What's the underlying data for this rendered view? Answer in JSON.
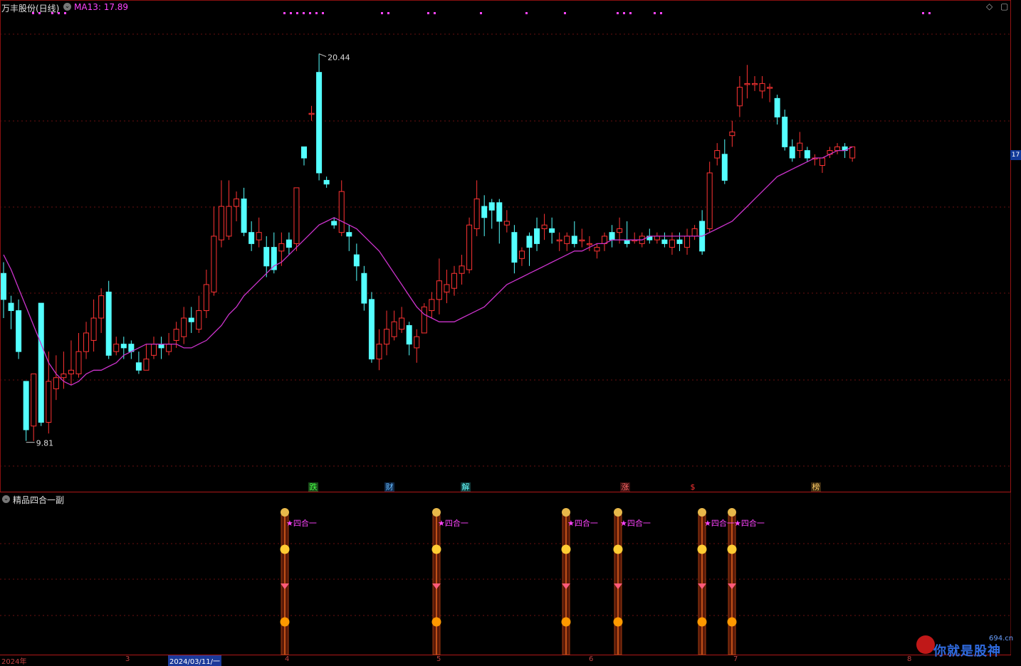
{
  "header": {
    "stock_title": "万丰股份(日线)",
    "ma_label": "MA13: 17.89",
    "collapse_glyph": "⌄",
    "diamond_icon": "◇",
    "window_icon": "▢"
  },
  "chart_data": {
    "type": "candlestick",
    "ylim": [
      9,
      21.5
    ],
    "up_color": "#ff3333",
    "down_color": "#54ffff",
    "ma_color": "#cc33cc",
    "high_label": "20.44",
    "low_label": "9.81",
    "right_price_tag": "17",
    "candles": [
      [
        14.5,
        13.8,
        14.8,
        13.3
      ],
      [
        13.7,
        13.5,
        13.9,
        13.0
      ],
      [
        13.5,
        12.4,
        13.8,
        12.2
      ],
      [
        11.6,
        10.3,
        11.6,
        10.0
      ],
      [
        10.4,
        11.8,
        11.8,
        10.0
      ],
      [
        13.7,
        10.5,
        13.7,
        10.4
      ],
      [
        10.5,
        11.6,
        12.4,
        10.2
      ],
      [
        11.4,
        11.7,
        12.3,
        11.1
      ],
      [
        11.7,
        11.8,
        12.4,
        11.4
      ],
      [
        11.8,
        11.9,
        12.7,
        11.5
      ],
      [
        11.8,
        12.4,
        12.9,
        11.7
      ],
      [
        12.4,
        12.9,
        13.2,
        12.2
      ],
      [
        12.7,
        13.3,
        13.8,
        12.4
      ],
      [
        13.3,
        13.9,
        14.1,
        12.9
      ],
      [
        14.0,
        12.3,
        14.3,
        12.2
      ],
      [
        12.4,
        12.6,
        12.8,
        12.3
      ],
      [
        12.6,
        12.5,
        12.8,
        12.2
      ],
      [
        12.6,
        12.4,
        12.7,
        12.2
      ],
      [
        12.1,
        11.9,
        12.4,
        11.8
      ],
      [
        11.9,
        12.2,
        12.6,
        11.9
      ],
      [
        12.3,
        12.6,
        12.8,
        12.2
      ],
      [
        12.6,
        12.5,
        12.8,
        12.2
      ],
      [
        12.4,
        12.6,
        12.9,
        12.3
      ],
      [
        12.7,
        13.0,
        13.2,
        12.5
      ],
      [
        12.8,
        13.3,
        13.6,
        12.6
      ],
      [
        13.3,
        13.2,
        13.6,
        12.9
      ],
      [
        13.0,
        13.5,
        13.9,
        12.9
      ],
      [
        13.5,
        14.2,
        14.6,
        13.3
      ],
      [
        14.0,
        15.5,
        16.3,
        13.9
      ],
      [
        15.4,
        16.3,
        17.0,
        15.2
      ],
      [
        15.5,
        16.3,
        17.0,
        15.4
      ],
      [
        16.3,
        16.5,
        16.7,
        15.9
      ],
      [
        16.5,
        15.6,
        16.8,
        15.5
      ],
      [
        15.6,
        15.3,
        15.9,
        15.1
      ],
      [
        15.4,
        15.6,
        16.0,
        15.2
      ],
      [
        15.2,
        14.7,
        15.5,
        14.4
      ],
      [
        15.2,
        14.6,
        15.6,
        14.5
      ],
      [
        15.1,
        15.3,
        15.6,
        14.7
      ],
      [
        15.4,
        15.2,
        15.6,
        15.0
      ],
      [
        15.3,
        16.8,
        16.8,
        15.1
      ],
      [
        17.9,
        17.6,
        17.9,
        17.4
      ],
      [
        18.8,
        18.8,
        19.0,
        18.6
      ],
      [
        19.9,
        17.2,
        20.4,
        17.0
      ],
      [
        17.0,
        16.9,
        17.1,
        16.8
      ],
      [
        15.9,
        15.8,
        16.0,
        15.7
      ],
      [
        15.6,
        16.7,
        17.0,
        15.5
      ],
      [
        15.6,
        15.5,
        15.8,
        15.1
      ],
      [
        15.0,
        14.7,
        15.3,
        14.3
      ],
      [
        14.5,
        13.7,
        14.7,
        13.5
      ],
      [
        13.8,
        12.2,
        14.0,
        12.1
      ],
      [
        12.2,
        12.6,
        13.0,
        11.9
      ],
      [
        12.6,
        13.0,
        13.5,
        12.3
      ],
      [
        12.8,
        13.2,
        13.5,
        12.7
      ],
      [
        13.0,
        13.3,
        13.6,
        12.9
      ],
      [
        13.1,
        12.6,
        13.2,
        12.3
      ],
      [
        12.5,
        12.8,
        13.0,
        12.1
      ],
      [
        12.9,
        13.6,
        13.7,
        12.9
      ],
      [
        13.5,
        13.8,
        14.0,
        13.3
      ],
      [
        13.8,
        14.3,
        14.9,
        13.4
      ],
      [
        14.0,
        14.2,
        14.6,
        13.7
      ],
      [
        14.1,
        14.5,
        14.7,
        13.9
      ],
      [
        14.5,
        14.7,
        15.0,
        14.2
      ],
      [
        14.6,
        15.8,
        16.0,
        14.5
      ],
      [
        15.7,
        16.5,
        17.0,
        15.5
      ],
      [
        16.3,
        16.0,
        16.6,
        15.5
      ],
      [
        16.4,
        16.2,
        16.5,
        15.7
      ],
      [
        16.4,
        15.9,
        16.5,
        15.3
      ],
      [
        15.8,
        15.9,
        16.2,
        15.6
      ],
      [
        15.6,
        14.8,
        15.8,
        14.5
      ],
      [
        14.9,
        15.1,
        15.2,
        14.7
      ],
      [
        15.5,
        15.2,
        15.6,
        14.7
      ],
      [
        15.7,
        15.3,
        16.0,
        15.1
      ],
      [
        15.7,
        15.8,
        16.1,
        15.4
      ],
      [
        15.7,
        15.6,
        16.0,
        15.3
      ],
      [
        15.4,
        15.4,
        15.6,
        15.1
      ],
      [
        15.3,
        15.5,
        15.6,
        15.1
      ],
      [
        15.5,
        15.3,
        15.9,
        15.2
      ],
      [
        15.4,
        15.4,
        15.7,
        15.2
      ],
      [
        15.3,
        15.3,
        15.5,
        15.1
      ],
      [
        15.1,
        15.2,
        15.3,
        14.9
      ],
      [
        15.3,
        15.5,
        15.6,
        15.1
      ],
      [
        15.6,
        15.4,
        15.8,
        15.2
      ],
      [
        15.6,
        15.7,
        16.0,
        15.3
      ],
      [
        15.4,
        15.3,
        15.9,
        15.2
      ],
      [
        15.4,
        15.4,
        15.6,
        15.3
      ],
      [
        15.3,
        15.5,
        15.6,
        15.2
      ],
      [
        15.5,
        15.4,
        15.7,
        15.3
      ],
      [
        15.4,
        15.5,
        15.6,
        15.3
      ],
      [
        15.4,
        15.3,
        15.6,
        15.2
      ],
      [
        15.2,
        15.4,
        15.6,
        15.0
      ],
      [
        15.4,
        15.3,
        15.6,
        15.1
      ],
      [
        15.2,
        15.5,
        15.7,
        15.0
      ],
      [
        15.5,
        15.7,
        15.8,
        15.4
      ],
      [
        15.9,
        15.1,
        16.2,
        15.0
      ],
      [
        15.7,
        17.2,
        17.5,
        15.6
      ],
      [
        17.6,
        17.8,
        18.0,
        17.4
      ],
      [
        17.7,
        17.0,
        18.1,
        16.9
      ],
      [
        18.2,
        18.3,
        18.6,
        17.9
      ],
      [
        19.0,
        19.5,
        19.8,
        18.7
      ],
      [
        19.6,
        19.6,
        20.1,
        19.2
      ],
      [
        19.6,
        19.6,
        19.8,
        19.4
      ],
      [
        19.4,
        19.6,
        19.8,
        19.2
      ],
      [
        19.5,
        19.5,
        19.6,
        19.1
      ],
      [
        19.2,
        18.7,
        19.3,
        18.5
      ],
      [
        18.7,
        17.9,
        18.9,
        17.8
      ],
      [
        17.9,
        17.6,
        18.1,
        17.5
      ],
      [
        17.8,
        18.0,
        18.3,
        17.6
      ],
      [
        17.8,
        17.6,
        17.9,
        17.5
      ],
      [
        17.6,
        17.6,
        17.7,
        17.4
      ],
      [
        17.4,
        17.6,
        17.6,
        17.2
      ],
      [
        17.7,
        17.8,
        17.9,
        17.6
      ],
      [
        17.8,
        17.9,
        18.0,
        17.7
      ],
      [
        17.9,
        17.8,
        18.0,
        17.6
      ],
      [
        17.6,
        17.9,
        17.9,
        17.5
      ]
    ],
    "ma13": [
      15.0,
      14.6,
      14.1,
      13.6,
      13.1,
      12.6,
      12.1,
      11.8,
      11.6,
      11.5,
      11.6,
      11.8,
      11.9,
      11.9,
      12.0,
      12.1,
      12.3,
      12.4,
      12.5,
      12.6,
      12.6,
      12.6,
      12.6,
      12.6,
      12.5,
      12.5,
      12.6,
      12.7,
      12.9,
      13.1,
      13.4,
      13.6,
      13.9,
      14.1,
      14.3,
      14.5,
      14.7,
      14.8,
      15.0,
      15.2,
      15.4,
      15.6,
      15.8,
      15.9,
      16.0,
      15.9,
      15.8,
      15.7,
      15.5,
      15.3,
      15.1,
      14.8,
      14.5,
      14.2,
      13.9,
      13.6,
      13.4,
      13.3,
      13.2,
      13.2,
      13.2,
      13.3,
      13.4,
      13.5,
      13.6,
      13.8,
      14.0,
      14.2,
      14.3,
      14.4,
      14.5,
      14.6,
      14.7,
      14.8,
      14.9,
      15.0,
      15.1,
      15.1,
      15.2,
      15.3,
      15.3,
      15.4,
      15.4,
      15.4,
      15.4,
      15.4,
      15.5,
      15.5,
      15.5,
      15.5,
      15.5,
      15.5,
      15.5,
      15.5,
      15.6,
      15.7,
      15.8,
      15.9,
      16.1,
      16.3,
      16.5,
      16.7,
      16.9,
      17.1,
      17.2,
      17.3,
      17.4,
      17.5,
      17.6,
      17.6,
      17.7,
      17.8,
      17.8,
      17.9
    ]
  },
  "event_badges": [
    {
      "label": "跌",
      "color": "#44ff44"
    },
    {
      "label": "财",
      "color": "#44aaff"
    },
    {
      "label": "解",
      "color": "#44ffff"
    },
    {
      "label": "涨",
      "color": "#ff4444"
    },
    {
      "label": "$",
      "color": "#ff3333"
    },
    {
      "label": "榜",
      "color": "#ffcc66"
    }
  ],
  "indicator": {
    "title": "精品四合一副",
    "signal_label": "★四合一",
    "signal_count": 6
  },
  "axis": {
    "labels": [
      "2024年",
      "3",
      "2024/03/11/一",
      "4",
      "5",
      "6",
      "7",
      "8"
    ]
  },
  "watermark": {
    "text": "你就是股神",
    "url": "694.cn"
  }
}
